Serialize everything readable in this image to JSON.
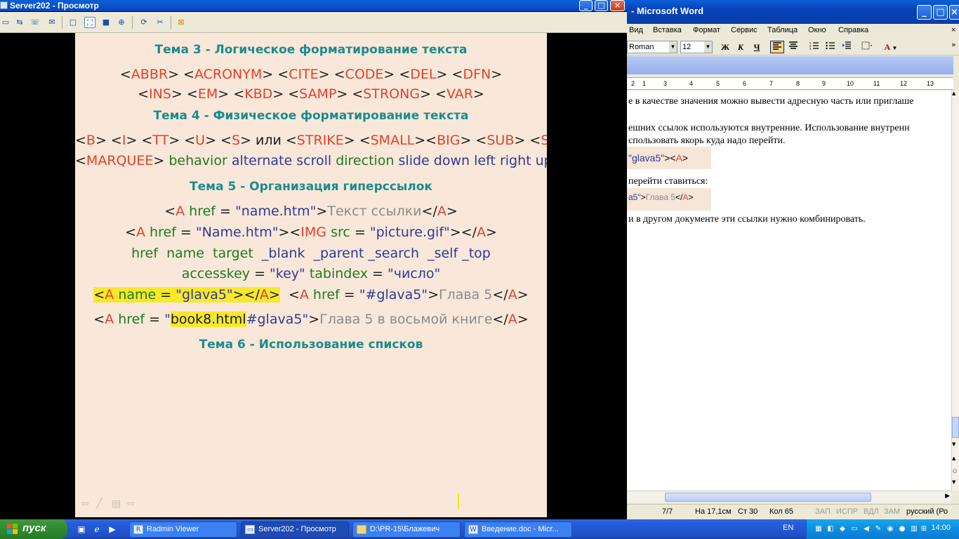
{
  "word": {
    "title": "- Microsoft Word",
    "menu": [
      "Вид",
      "Вставка",
      "Формат",
      "Сервис",
      "Таблица",
      "Окно",
      "Справка"
    ],
    "font_name": "Roman",
    "font_size": "12",
    "bold_btn": "Ж",
    "italic_btn": "К",
    "underline_btn": "Ч",
    "font_color_btn": "A",
    "ruler": [
      "2",
      "1",
      "3",
      "4",
      "5",
      "6",
      "7",
      "8",
      "9",
      "10",
      "11",
      "12",
      "13"
    ],
    "doc_lines": {
      "l1": "е в качестве значения можно вывести адресную часть или приглаше",
      "l2": "ешних ссылок используются внутренние. Использование внутренн",
      "l3": "спользовать якорь куда надо перейти.",
      "code1_val": "\"glava5\"",
      "code1_open": "><",
      "code1_tag": "A",
      "code1_close": ">",
      "l4": "перейти ставиться:",
      "code2_val": "a5\"",
      "code2_mid": ">",
      "code2_text": "Глава 5",
      "code2_lt": "</",
      "code2_tag": "A",
      "code2_close": ">",
      "l5": "и в другом документе эти ссылки нужно комбинировать."
    },
    "status": {
      "pages": "7/7",
      "position": "На 17,1см",
      "line": "Ст 30",
      "col": "Кол 65",
      "rec": "ЗАП",
      "trk": "ИСПР",
      "ext": "ВДЛ",
      "ovr": "ЗАМ",
      "lang": "русский (Ро"
    }
  },
  "viewer": {
    "title": "Server202 - Просмотр"
  },
  "slide": {
    "topic3": "Тема 3 - Логическое форматирование текста",
    "topic3_tags_1": [
      "ABBR",
      "ACRONYM",
      "CITE",
      "CODE",
      "DEL",
      "DFN"
    ],
    "topic3_tags_2": [
      "INS",
      "EM",
      "KBD",
      "SAMP",
      "STRONG",
      "VAR"
    ],
    "topic4": "Тема 4 - Физическое форматирование текста",
    "topic4_tags": [
      "B",
      "I",
      "TT",
      "U",
      "S",
      "STRIKE",
      "SMALL",
      "BIG",
      "SUB",
      "SUP"
    ],
    "or_word": "или",
    "marquee_tag": "MARQUEE",
    "marquee_attrs": {
      "behavior": "behavior",
      "alternate": "alternate",
      "scroll": "scroll",
      "direction": "direction",
      "slide": "slide",
      "down": "down",
      "left": "left",
      "right": "right",
      "up": "up"
    },
    "topic5": "Тема 5 - Организация гиперссылок",
    "link1": {
      "tag": "A",
      "attr": "href",
      "eq": "=",
      "value": "\"name.htm\"",
      "text": "Текст ссылки"
    },
    "link2": {
      "tag": "A",
      "attr": "href",
      "value": "\"Name.htm\"",
      "img": "IMG",
      "src": "src",
      "src_value": "\"picture.gif\""
    },
    "attrs_line": [
      "href",
      "name",
      "target",
      "_blank",
      "_parent",
      "_search",
      "_self",
      "_top"
    ],
    "access_line": {
      "accesskey": "accesskey",
      "key": "\"key\"",
      "tabindex": "tabindex",
      "num": "\"число\""
    },
    "anchor": {
      "name_attr": "name",
      "name_val": "\"glava5\"",
      "href_val": "\"#glava5\"",
      "text": "Глава 5"
    },
    "book": {
      "file": "book8.html",
      "hash": "#glava5\"",
      "quote": "\"",
      "text": "Глава 5 в восьмой книге"
    },
    "topic6": "Тема 6 - Использование списков"
  },
  "taskbar": {
    "start": "пуск",
    "tasks": [
      "Radmin Viewer",
      "Server202 - Просмотр",
      "D:\\PR-15\\Блажевич",
      "Введение.doc - Micr..."
    ],
    "lang": "EN",
    "clock": "14:00"
  }
}
